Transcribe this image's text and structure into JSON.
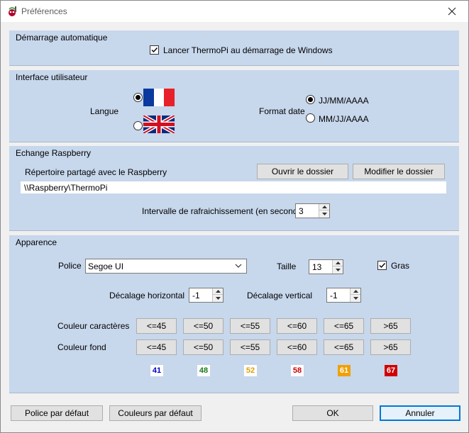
{
  "window": {
    "title": "Préférences"
  },
  "startup": {
    "title": "Démarrage automatique",
    "launch_label": "Lancer ThermoPi au démarrage de Windows",
    "launch_checked": true
  },
  "ui": {
    "title": "Interface utilisateur",
    "language_label": "Langue",
    "languages": [
      {
        "flag": "france-flag-icon",
        "selected": true
      },
      {
        "flag": "uk-flag-icon",
        "selected": false
      }
    ],
    "date_format_label": "Format date",
    "date_formats": [
      {
        "label": "JJ/MM/AAAA",
        "selected": true
      },
      {
        "label": "MM/JJ/AAAA",
        "selected": false
      }
    ]
  },
  "raspberry": {
    "title": "Echange Raspberry",
    "shared_dir_label": "Répertoire partagé avec le Raspberry",
    "open_folder_button": "Ouvrir le dossier",
    "modify_folder_button": "Modifier le dossier",
    "shared_dir_value": "\\\\Raspberry\\ThermoPi",
    "refresh_label": "Intervalle de rafraichissement (en secondes)",
    "refresh_value": "3"
  },
  "appearance": {
    "title": "Apparence",
    "font_label": "Police",
    "font_value": "Segoe UI",
    "size_label": "Taille",
    "size_value": "13",
    "bold_label": "Gras",
    "bold_checked": true,
    "offset_h_label": "Décalage horizontal",
    "offset_h_value": "-1",
    "offset_v_label": "Décalage vertical",
    "offset_v_value": "-1",
    "char_color_label": "Couleur caractères",
    "bg_color_label": "Couleur fond",
    "thresholds": [
      "<=45",
      "<=50",
      "<=55",
      "<=60",
      "<=65",
      ">65"
    ],
    "samples": [
      {
        "value": "41",
        "fg": "#0000c8",
        "bg": "#ffffff"
      },
      {
        "value": "48",
        "fg": "#1a7a1a",
        "bg": "#ffffff"
      },
      {
        "value": "52",
        "fg": "#e0a000",
        "bg": "#ffffff"
      },
      {
        "value": "58",
        "fg": "#d00000",
        "bg": "#ffffff"
      },
      {
        "value": "61",
        "fg": "#ffffff",
        "bg": "#f0a000"
      },
      {
        "value": "67",
        "fg": "#ffffff",
        "bg": "#d00000"
      }
    ]
  },
  "footer": {
    "default_font_button": "Police par défaut",
    "default_colors_button": "Couleurs par défaut",
    "ok_button": "OK",
    "cancel_button": "Annuler"
  },
  "colors": {
    "group_bg": "#c7d7ec",
    "client_bg": "#f0f0f0",
    "accent": "#0078d7"
  }
}
